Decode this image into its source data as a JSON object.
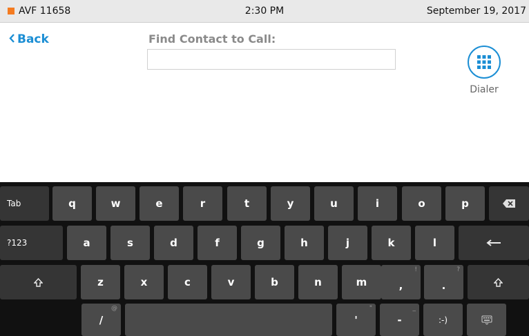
{
  "status_bar": {
    "device_name": "AVF 11658",
    "time": "2:30 PM",
    "date": "September 19, 2017",
    "indicator_color": "#f47b20"
  },
  "nav": {
    "back_label": "Back"
  },
  "search": {
    "label": "Find Contact to Call:",
    "value": "",
    "placeholder": ""
  },
  "dialer": {
    "label": "Dialer",
    "icon": "keypad-grid-icon",
    "accent_color": "#1b8ed4"
  },
  "keyboard": {
    "row1": {
      "tab": "Tab",
      "letters": [
        "q",
        "w",
        "e",
        "r",
        "t",
        "y",
        "u",
        "i",
        "o",
        "p"
      ],
      "backspace_icon": "backspace-icon"
    },
    "row2": {
      "symbols": "?123",
      "letters": [
        "a",
        "s",
        "d",
        "f",
        "g",
        "h",
        "j",
        "k",
        "l"
      ],
      "enter_icon": "enter-icon"
    },
    "row3": {
      "shift_icon": "shift-icon",
      "letters": [
        "z",
        "x",
        "c",
        "v",
        "b",
        "n",
        "m"
      ],
      "comma": ",",
      "comma_hint": "!",
      "period": ".",
      "period_hint": "?"
    },
    "row4": {
      "slash": "/",
      "slash_hint": "@",
      "apostrophe": "'",
      "apostrophe_hint": "\"",
      "dash": "-",
      "dash_hint": "_",
      "smiley": ":-)",
      "hide_icon": "keyboard-hide-icon"
    }
  }
}
